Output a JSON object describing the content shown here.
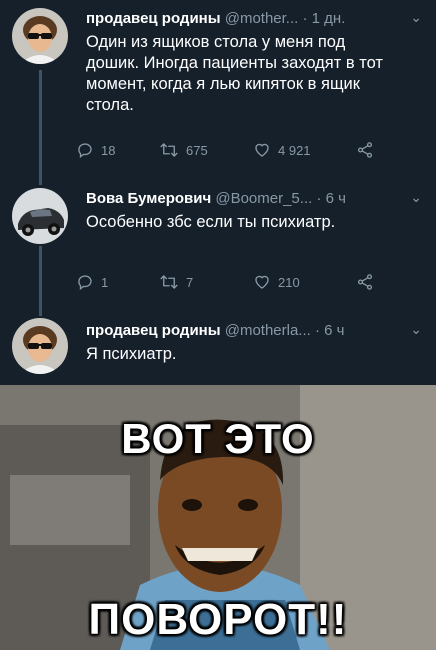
{
  "tweets": [
    {
      "name": "продавец родины",
      "handle": "@mother...",
      "dot": "·",
      "time": "1 дн.",
      "text_lines": [
        "Один из ящиков стола у меня под",
        "дошик. Иногда пациенты заходят в тот",
        "момент, когда я лью кипяток в ящик",
        "стола."
      ],
      "replies": "18",
      "retweets": "675",
      "likes": "4 921",
      "avatar": "boy-with-sunglasses-avatar"
    },
    {
      "name": "Вова Бумерович",
      "handle": "@Boomer_5...",
      "dot": "·",
      "time": "6 ч",
      "text_lines": [
        "Особенно збс если ты психиатр."
      ],
      "replies": "1",
      "retweets": "7",
      "likes": "210",
      "avatar": "car-avatar"
    },
    {
      "name": "продавец родины",
      "handle": "@motherla...",
      "dot": "·",
      "time": "6 ч",
      "text_lines": [
        "Я психиатр."
      ]
    }
  ],
  "meme": {
    "top_caption": "ВОТ ЭТО",
    "bottom_caption": "ПОВОРОТ!!"
  },
  "icons": {
    "caret": "chevron-down-icon",
    "reply": "reply-icon",
    "retweet": "retweet-icon",
    "like": "heart-icon",
    "share": "share-icon"
  },
  "colors": {
    "background": "#15202b",
    "secondary_text": "#8899a6",
    "thread_line": "#3d5466"
  }
}
